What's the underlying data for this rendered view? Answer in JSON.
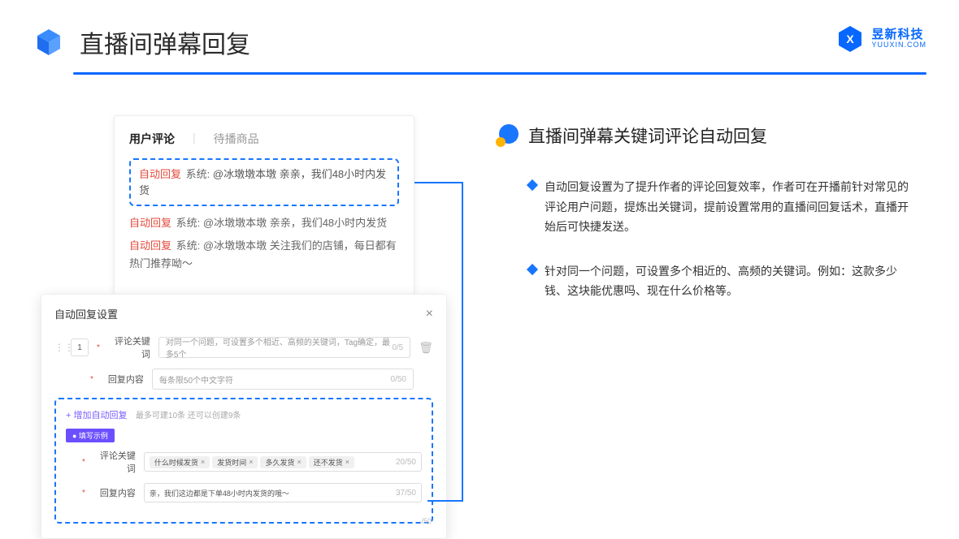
{
  "header": {
    "title": "直播间弹幕回复",
    "brand_cn": "昱新科技",
    "brand_en": "YUUXIN.COM"
  },
  "comments_card": {
    "tab_active": "用户评论",
    "tab_inactive": "待播商品",
    "auto_tag": "自动回复",
    "sys_tag": "系统:",
    "highlight_text": "@冰墩墩本墩 亲亲，我们48小时内发货",
    "line2": "@冰墩墩本墩 亲亲，我们48小时内发货",
    "line3": "@冰墩墩本墩 关注我们的店铺，每日都有热门推荐呦～"
  },
  "settings_card": {
    "title": "自动回复设置",
    "idx": "1",
    "label_keyword": "评论关键词",
    "placeholder_keyword": "对同一个问题，可设置多个相近、高频的关键词，Tag确定，最多5个",
    "count_keyword": "0/5",
    "label_content": "回复内容",
    "placeholder_content": "每条限50个中文字符",
    "count_content": "0/50",
    "add_link": "+ 增加自动回复",
    "add_hint": "最多可建10条 还可以创建9条",
    "badge": "● 填写示例",
    "ex_label_kw": "评论关键词",
    "ex_tags": [
      "什么时候发货",
      "发货时间",
      "多久发货",
      "还不发货"
    ],
    "ex_kw_count": "20/50",
    "ex_label_ct": "回复内容",
    "ex_content": "亲，我们这边都是下单48小时内发货的哦～",
    "ex_ct_count": "37/50",
    "hidden_ct": "/50"
  },
  "right": {
    "section_title": "直播间弹幕关键词评论自动回复",
    "bullet1": "自动回复设置为了提升作者的评论回复效率，作者可在开播前针对常见的评论用户问题，提炼出关键词，提前设置常用的直播间回复话术，直播开始后可快捷发送。",
    "bullet2": "针对同一个问题，可设置多个相近的、高频的关键词。例如：这款多少钱、这块能优惠吗、现在什么价格等。"
  }
}
